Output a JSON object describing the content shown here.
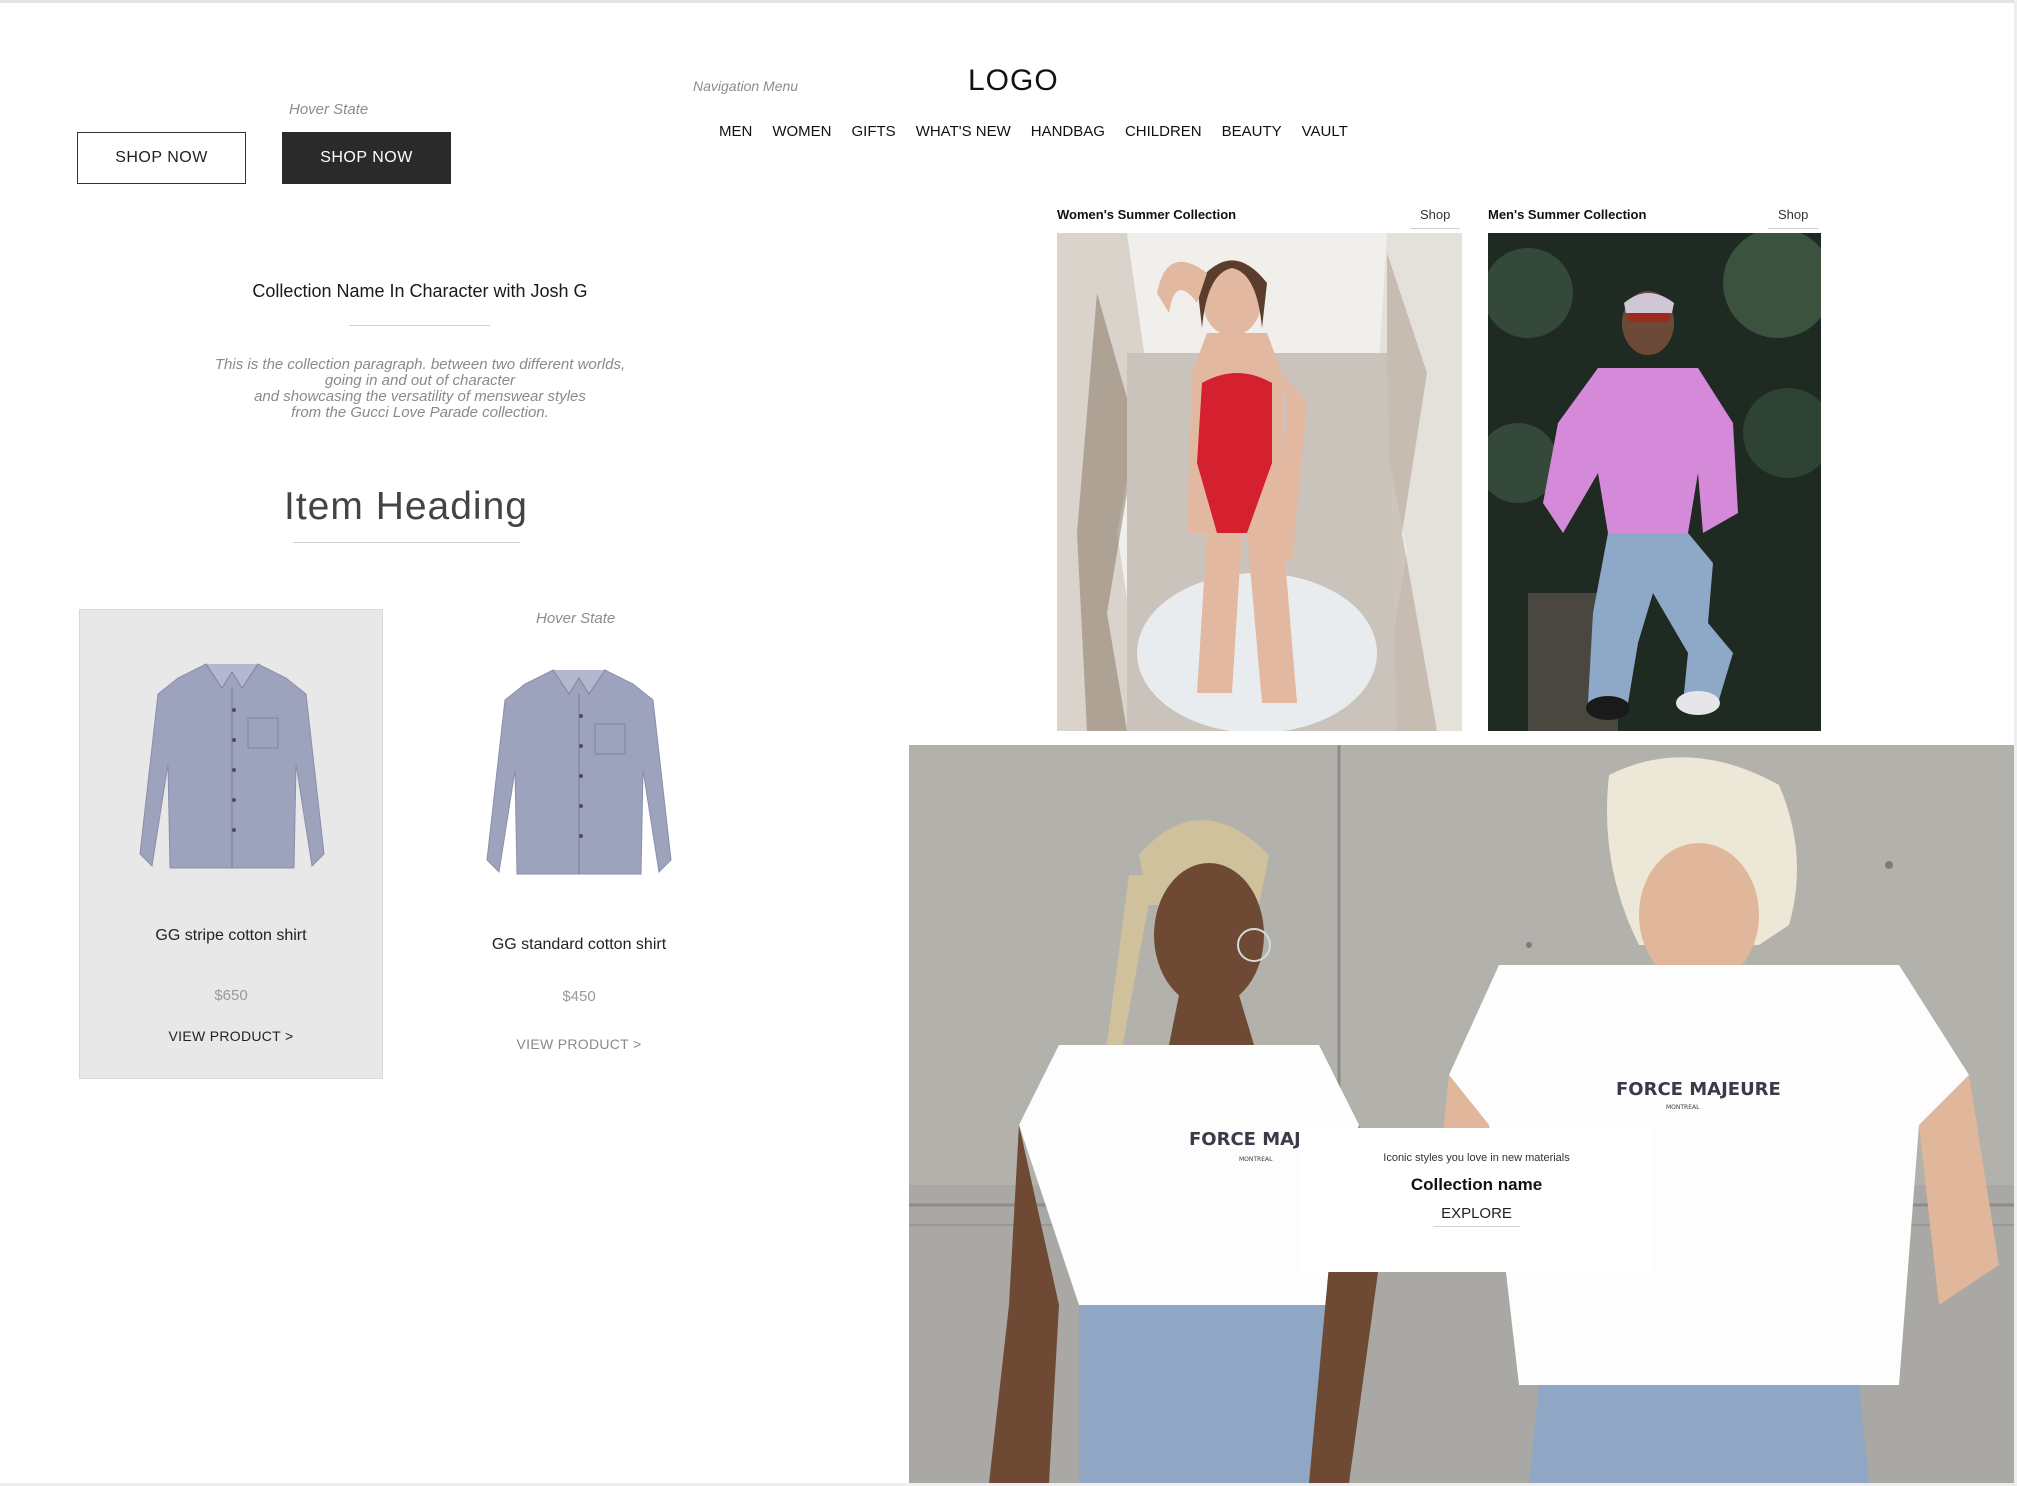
{
  "header": {
    "logo": "LOGO",
    "nav_note": "Navigation Menu",
    "nav_items": [
      "MEN",
      "WOMEN",
      "GIFTS",
      "WHAT'S NEW",
      "HANDBAG",
      "CHILDREN",
      "BEAUTY",
      "VAULT"
    ]
  },
  "buttons": {
    "hover_note": "Hover State",
    "default_label": "SHOP NOW",
    "hover_label": "SHOP NOW"
  },
  "collection": {
    "title": "Collection Name In Character with Josh G",
    "paragraph_lines": [
      "This is the collection paragraph. between two different worlds,",
      "going in and out of character",
      "and showcasing the versatility of menswear styles",
      "from the Gucci Love Parade collection."
    ],
    "item_heading": "Item Heading"
  },
  "products": {
    "hover_note": "Hover State",
    "items": [
      {
        "name": "GG stripe cotton shirt",
        "price": "$650",
        "link": "VIEW PRODUCT  >"
      },
      {
        "name": "GG standard cotton shirt",
        "price": "$450",
        "link": "VIEW PRODUCT  >"
      }
    ]
  },
  "panels": [
    {
      "title": "Women's Summer Collection",
      "link": "Shop"
    },
    {
      "title": "Men's Summer Collection",
      "link": "Shop"
    }
  ],
  "banner": {
    "tagline": "Iconic styles you love in new materials",
    "name": "Collection name",
    "cta": "EXPLORE",
    "shirt_text": "FORCE MAJEURE",
    "shirt_subtext": "MONTREAL"
  },
  "colors": {
    "dark_button": "#2a2a2a",
    "card_hover_bg": "#e8e8e8",
    "shirt_blue": "#9ea3bd",
    "swimsuit_red": "#d4202f",
    "sweater_pink": "#d48ad8"
  }
}
